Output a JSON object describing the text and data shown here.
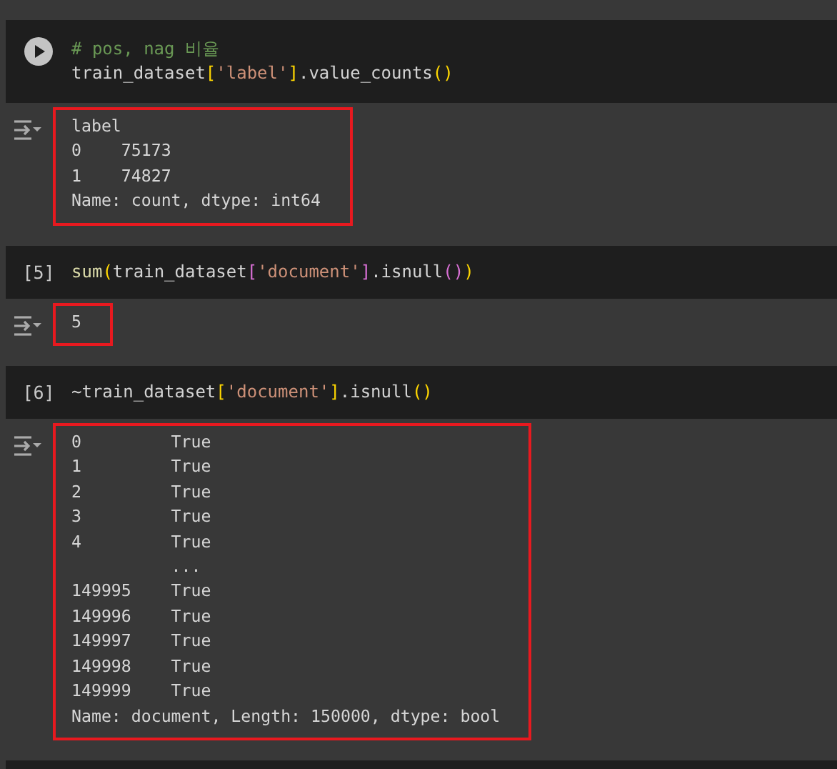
{
  "cells": [
    {
      "runner": {
        "kind": "play"
      },
      "code": [
        [
          {
            "kind": "comment",
            "text": "# pos, nag 비율"
          }
        ],
        [
          {
            "kind": "plain",
            "text": "train_dataset"
          },
          {
            "kind": "bracket1",
            "text": "["
          },
          {
            "kind": "string",
            "text": "'label'"
          },
          {
            "kind": "bracket1",
            "text": "]"
          },
          {
            "kind": "plain",
            "text": ".value_counts"
          },
          {
            "kind": "bracket1",
            "text": "()"
          }
        ]
      ],
      "output": {
        "highlighted": true,
        "lines": [
          "label",
          "0    75173",
          "1    74827",
          "Name: count, dtype: int64"
        ]
      }
    },
    {
      "runner": {
        "kind": "count",
        "text": "[5]"
      },
      "code": [
        [
          {
            "kind": "func",
            "text": "sum"
          },
          {
            "kind": "bracket1",
            "text": "("
          },
          {
            "kind": "plain",
            "text": "train_dataset"
          },
          {
            "kind": "bracket2",
            "text": "["
          },
          {
            "kind": "string",
            "text": "'document'"
          },
          {
            "kind": "bracket2",
            "text": "]"
          },
          {
            "kind": "plain",
            "text": ".isnull"
          },
          {
            "kind": "bracket2",
            "text": "()"
          },
          {
            "kind": "bracket1",
            "text": ")"
          }
        ]
      ],
      "output": {
        "highlighted": true,
        "lines": [
          "5"
        ]
      }
    },
    {
      "runner": {
        "kind": "count",
        "text": "[6]"
      },
      "code": [
        [
          {
            "kind": "plain",
            "text": "~train_dataset"
          },
          {
            "kind": "bracket1",
            "text": "["
          },
          {
            "kind": "string",
            "text": "'document'"
          },
          {
            "kind": "bracket1",
            "text": "]"
          },
          {
            "kind": "plain",
            "text": ".isnull"
          },
          {
            "kind": "bracket1",
            "text": "()"
          }
        ]
      ],
      "output": {
        "highlighted": true,
        "lines": [
          "0         True",
          "1         True",
          "2         True",
          "3         True",
          "4         True",
          "          ...",
          "149995    True",
          "149996    True",
          "149997    True",
          "149998    True",
          "149999    True",
          "Name: document, Length: 150000, dtype: bool"
        ]
      }
    }
  ]
}
